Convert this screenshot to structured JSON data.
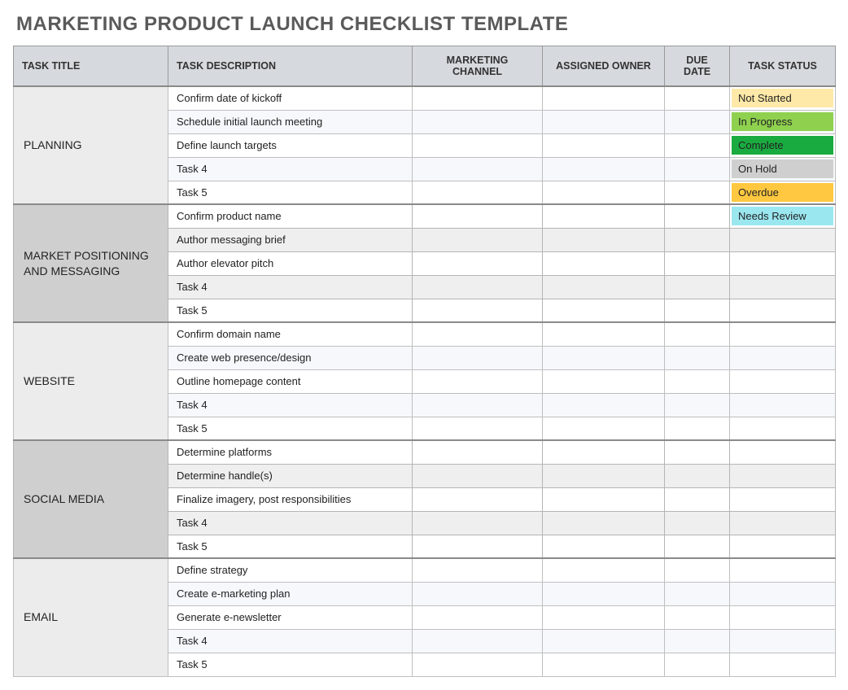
{
  "title": "MARKETING PRODUCT LAUNCH CHECKLIST TEMPLATE",
  "columns": {
    "task_title": "TASK TITLE",
    "task_description": "TASK DESCRIPTION",
    "marketing_channel": "MARKETING CHANNEL",
    "assigned_owner": "ASSIGNED OWNER",
    "due_date": "DUE DATE",
    "task_status": "TASK STATUS"
  },
  "status_colors": {
    "Not Started": "#ffe9a8",
    "In Progress": "#8fd14f",
    "Complete": "#1aab40",
    "On Hold": "#cfcfcf",
    "Overdue": "#ffc840",
    "Needs Review": "#9be7f0"
  },
  "categories": [
    {
      "name": "PLANNING",
      "shade": "light",
      "tasks": [
        {
          "description": "Confirm date of kickoff",
          "channel": "",
          "owner": "",
          "due": "",
          "status": "Not Started"
        },
        {
          "description": "Schedule initial launch meeting",
          "channel": "",
          "owner": "",
          "due": "",
          "status": "In Progress"
        },
        {
          "description": "Define launch targets",
          "channel": "",
          "owner": "",
          "due": "",
          "status": "Complete"
        },
        {
          "description": "Task 4",
          "channel": "",
          "owner": "",
          "due": "",
          "status": "On Hold"
        },
        {
          "description": "Task 5",
          "channel": "",
          "owner": "",
          "due": "",
          "status": "Overdue"
        }
      ]
    },
    {
      "name": "MARKET POSITIONING AND MESSAGING",
      "shade": "dark",
      "tasks": [
        {
          "description": "Confirm product name",
          "channel": "",
          "owner": "",
          "due": "",
          "status": "Needs Review"
        },
        {
          "description": "Author messaging brief",
          "channel": "",
          "owner": "",
          "due": "",
          "status": ""
        },
        {
          "description": "Author elevator pitch",
          "channel": "",
          "owner": "",
          "due": "",
          "status": ""
        },
        {
          "description": "Task 4",
          "channel": "",
          "owner": "",
          "due": "",
          "status": ""
        },
        {
          "description": "Task 5",
          "channel": "",
          "owner": "",
          "due": "",
          "status": ""
        }
      ]
    },
    {
      "name": "WEBSITE",
      "shade": "light",
      "tasks": [
        {
          "description": "Confirm domain name",
          "channel": "",
          "owner": "",
          "due": "",
          "status": ""
        },
        {
          "description": "Create web presence/design",
          "channel": "",
          "owner": "",
          "due": "",
          "status": ""
        },
        {
          "description": "Outline homepage content",
          "channel": "",
          "owner": "",
          "due": "",
          "status": ""
        },
        {
          "description": "Task 4",
          "channel": "",
          "owner": "",
          "due": "",
          "status": ""
        },
        {
          "description": "Task 5",
          "channel": "",
          "owner": "",
          "due": "",
          "status": ""
        }
      ]
    },
    {
      "name": "SOCIAL MEDIA",
      "shade": "dark",
      "tasks": [
        {
          "description": "Determine platforms",
          "channel": "",
          "owner": "",
          "due": "",
          "status": ""
        },
        {
          "description": "Determine handle(s)",
          "channel": "",
          "owner": "",
          "due": "",
          "status": ""
        },
        {
          "description": "Finalize imagery, post responsibilities",
          "channel": "",
          "owner": "",
          "due": "",
          "status": ""
        },
        {
          "description": "Task 4",
          "channel": "",
          "owner": "",
          "due": "",
          "status": ""
        },
        {
          "description": "Task 5",
          "channel": "",
          "owner": "",
          "due": "",
          "status": ""
        }
      ]
    },
    {
      "name": "EMAIL",
      "shade": "light",
      "tasks": [
        {
          "description": "Define strategy",
          "channel": "",
          "owner": "",
          "due": "",
          "status": ""
        },
        {
          "description": "Create e-marketing plan",
          "channel": "",
          "owner": "",
          "due": "",
          "status": ""
        },
        {
          "description": "Generate e-newsletter",
          "channel": "",
          "owner": "",
          "due": "",
          "status": ""
        },
        {
          "description": "Task 4",
          "channel": "",
          "owner": "",
          "due": "",
          "status": ""
        },
        {
          "description": "Task 5",
          "channel": "",
          "owner": "",
          "due": "",
          "status": ""
        }
      ]
    }
  ]
}
